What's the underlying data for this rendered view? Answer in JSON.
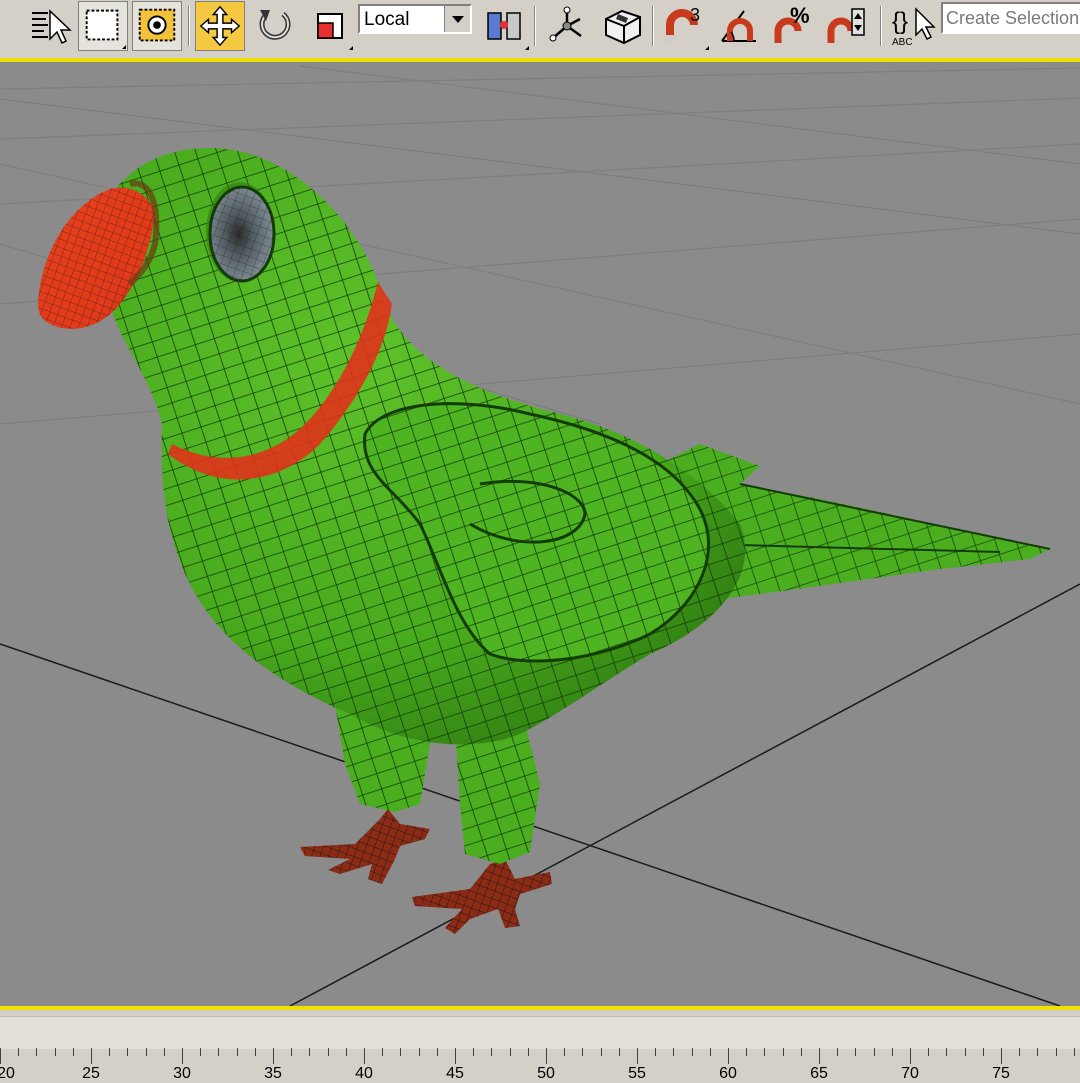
{
  "toolbar": {
    "tools": [
      {
        "name": "select-by-name",
        "icon": "select-by-name-icon"
      },
      {
        "name": "rectangular-selection-region",
        "icon": "rect-selection-icon"
      },
      {
        "name": "window-crossing",
        "icon": "window-crossing-icon"
      },
      {
        "name": "select-and-move",
        "icon": "move-icon",
        "active": true
      },
      {
        "name": "select-and-rotate",
        "icon": "rotate-icon"
      },
      {
        "name": "select-and-scale",
        "icon": "scale-icon"
      },
      {
        "name": "use-pivot-center",
        "icon": "pivot-center-icon"
      },
      {
        "name": "select-and-manipulate",
        "icon": "manipulate-icon"
      },
      {
        "name": "keyboard-shortcut-override",
        "icon": "keyboard-override-icon"
      },
      {
        "name": "snaps-toggle",
        "icon": "snap-3d-icon"
      },
      {
        "name": "angle-snap-toggle",
        "icon": "angle-snap-icon"
      },
      {
        "name": "percent-snap-toggle",
        "icon": "percent-snap-icon"
      },
      {
        "name": "spinner-snap-toggle",
        "icon": "spinner-snap-icon"
      },
      {
        "name": "edit-named-selection-sets",
        "icon": "named-selection-icon"
      }
    ],
    "snap_label": "3",
    "reference_coordinate_system": "Local",
    "named_selection_placeholder": "Create Selection Set"
  },
  "viewport": {
    "object": "parrot-mesh",
    "colors": {
      "body": "#4aae1f",
      "beak": "#e8401c",
      "collar": "#e0321a",
      "feet": "#8c2a14",
      "eye": "#707c84",
      "background": "#8b8b8b",
      "active_border": "#f0e000"
    }
  },
  "trackbar": {
    "labels": [
      "20",
      "25",
      "30",
      "35",
      "40",
      "45",
      "50",
      "55",
      "60",
      "65",
      "70",
      "75"
    ]
  }
}
